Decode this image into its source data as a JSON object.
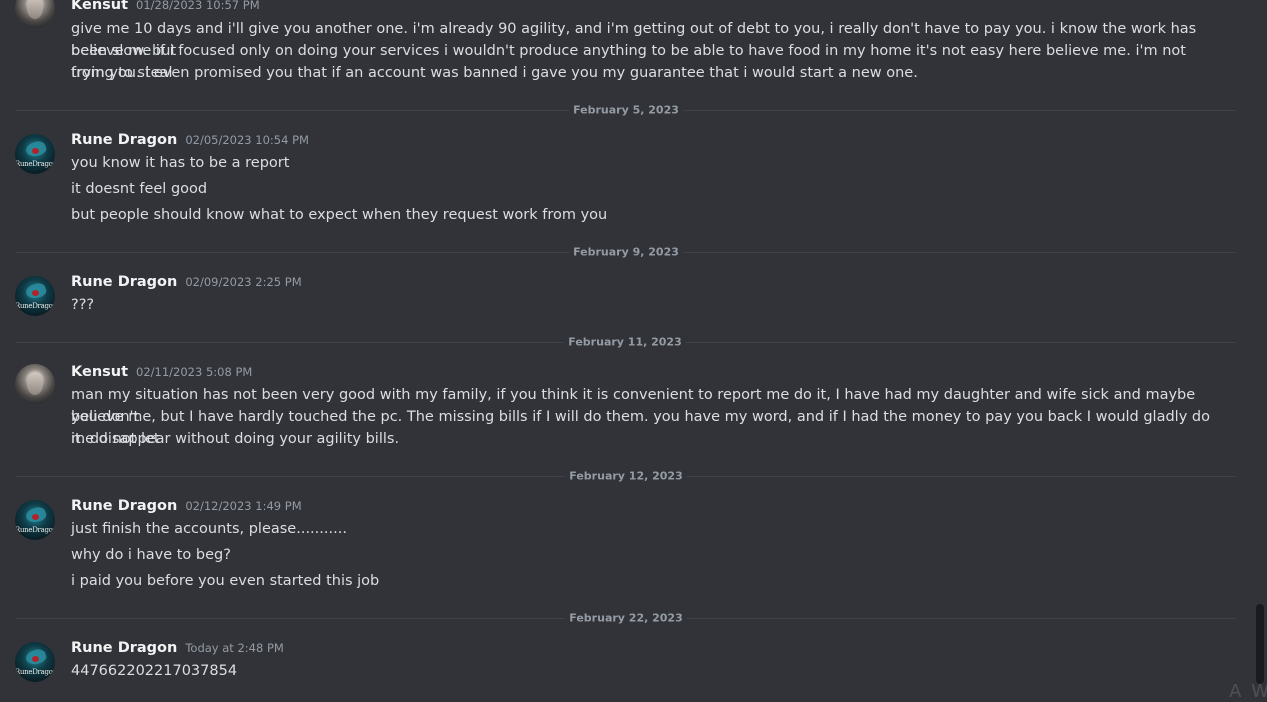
{
  "messages": {
    "m1": {
      "user": "Kensut",
      "time": "01/28/2023 10:57 PM",
      "lines": [
        "give me 10 days and i'll give you another one. i'm already 90 agility, and i'm getting out of debt to you, i really don't have to pay you. i know the work has been slow. but",
        "believe me if i focused only on doing your services i wouldn't produce anything to be able to have food in my home it's not easy here believe me. i'm not trying to steal",
        "from you. i even promised you that if an account was banned i gave you my guarantee that i would start a new one."
      ]
    },
    "m2": {
      "user": "Rune Dragon",
      "time": "02/05/2023 10:54 PM",
      "lines": [
        "you know it has to be a report",
        "it doesnt feel good",
        "but people should know what to expect when they request work from you"
      ]
    },
    "m3": {
      "user": "Rune Dragon",
      "time": "02/09/2023 2:25 PM",
      "lines": [
        "???"
      ]
    },
    "m4": {
      "user": "Kensut",
      "time": "02/11/2023 5:08 PM",
      "lines": [
        "man my situation has not been very good with my family, if you think it is convenient to report me do it, I have had my daughter and wife sick and maybe you don't",
        "believe me, but I have hardly touched the pc. The missing bills if I will do them. you have my word, and if I had the money to pay you back I would gladly do it. do not let",
        "me disappear without doing your agility bills."
      ]
    },
    "m5": {
      "user": "Rune Dragon",
      "time": "02/12/2023 1:49 PM",
      "lines": [
        "just finish the accounts, please...........",
        "why do i have to beg?",
        "i paid you before you even started this job"
      ]
    },
    "m6": {
      "user": "Rune Dragon",
      "time": "Today at 2:48 PM",
      "lines": [
        "447662202217037854"
      ]
    }
  },
  "dividers": {
    "d1": "February 5, 2023",
    "d2": "February 9, 2023",
    "d3": "February 11, 2023",
    "d4": "February 12, 2023",
    "d5": "February 22, 2023"
  },
  "avatar_rune_text": "RuneDragon",
  "watermark": "A W",
  "colors": {
    "background": "#313338",
    "username": "#f2f3f5",
    "text": "#dbdee1",
    "muted": "#949ba4"
  },
  "icons": {
    "kensut_avatar": "user-avatar-portrait",
    "rune_avatar": "user-avatar-dragon"
  }
}
